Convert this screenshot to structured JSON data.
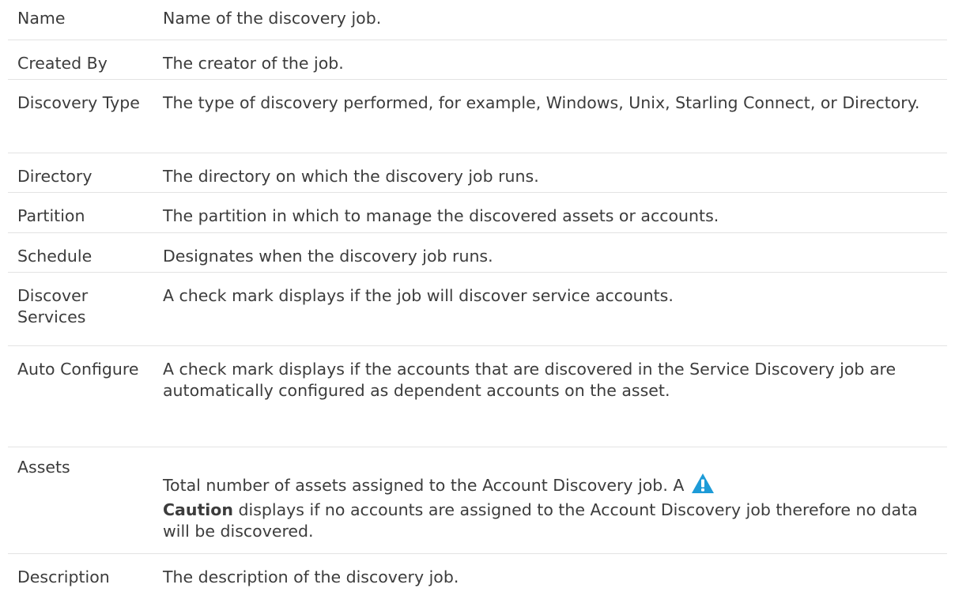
{
  "rows": [
    {
      "term": "Name",
      "desc": "Name of the discovery job."
    },
    {
      "term": "Created By",
      "desc": "The creator of the job."
    },
    {
      "term": "Discovery Type",
      "desc": "The type of discovery performed, for example, Windows, Unix, Starling Connect, or Directory."
    },
    {
      "term": "Directory",
      "desc": "The directory on which the discovery job runs."
    },
    {
      "term": "Partition",
      "desc": "The partition in which to manage the discovered assets or accounts."
    },
    {
      "term": "Schedule",
      "desc": "Designates when the discovery job runs."
    },
    {
      "term": "Discover Services",
      "desc": "A check mark displays if the job will discover service accounts."
    },
    {
      "term": "Auto Configure",
      "desc": "A check mark displays if the accounts that are discovered in the Service Discovery job are automatically configured as dependent accounts on the asset."
    },
    {
      "term": "Assets",
      "desc_prefix": "Total number of assets assigned to the Account Discovery job. A",
      "desc_bold": "Caution",
      "desc_suffix": "displays if no accounts are assigned to the Account Discovery job therefore no data will be discovered.",
      "icon": "caution-warning-icon"
    },
    {
      "term": "Description",
      "desc": "The description of the discovery job."
    }
  ],
  "colors": {
    "text": "#3c3c3c",
    "divider": "#e3e3e3",
    "caution_icon": "#1d9bd7"
  }
}
